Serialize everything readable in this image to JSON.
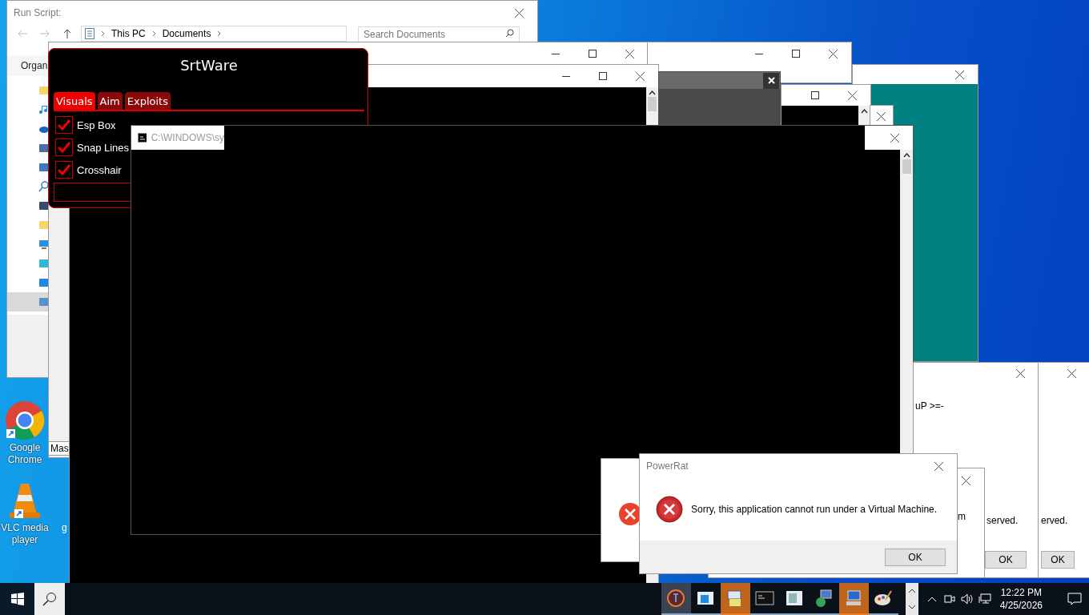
{
  "explorer": {
    "title": "Run Script:",
    "path": [
      "This PC",
      "Documents"
    ],
    "search": {
      "placeholder": "Search Documents"
    },
    "toolbar_label": "Organ"
  },
  "hidden_window": {
    "label": "Mas"
  },
  "desktop_icons": [
    {
      "label": "Google Chrome",
      "kind": "chrome"
    },
    {
      "label": "VLC media player",
      "kind": "vlc"
    },
    {
      "label": "g",
      "kind": "partial"
    }
  ],
  "srtware": {
    "title": "SrtWare",
    "tabs": [
      {
        "label": "Visuals",
        "selected": true
      },
      {
        "label": "Aim",
        "selected": false
      },
      {
        "label": "Exploits",
        "selected": false
      }
    ],
    "options": [
      {
        "label": "Esp Box",
        "checked": true
      },
      {
        "label": "Snap Lines",
        "checked": true
      },
      {
        "label": "Crosshair",
        "checked": true
      }
    ]
  },
  "console": {
    "title": "C:\\WINDOWS\\sy"
  },
  "back_dialogs": {
    "text_1": "uP >=-",
    "text_2": "m",
    "text_3": "served.",
    "text_4": "erved.",
    "buttons": [
      "OK",
      "OK"
    ]
  },
  "dialog": {
    "title": "PowerRat",
    "message": "Sorry, this application cannot run under a Virtual Machine.",
    "button": "OK"
  },
  "taskbar": {
    "apps": [
      {
        "kind": "ring",
        "selected": true,
        "flashing": false
      },
      {
        "kind": "window",
        "selected": false,
        "flashing": false
      },
      {
        "kind": "installer",
        "selected": false,
        "flashing": true
      },
      {
        "kind": "console",
        "selected": false,
        "flashing": false
      },
      {
        "kind": "document",
        "selected": false,
        "flashing": false
      },
      {
        "kind": "network",
        "selected": false,
        "flashing": false
      },
      {
        "kind": "computer",
        "selected": false,
        "flashing": true
      },
      {
        "kind": "palette",
        "selected": false,
        "flashing": false
      }
    ],
    "time": "12:22 PM",
    "date": "4/25/2026"
  }
}
